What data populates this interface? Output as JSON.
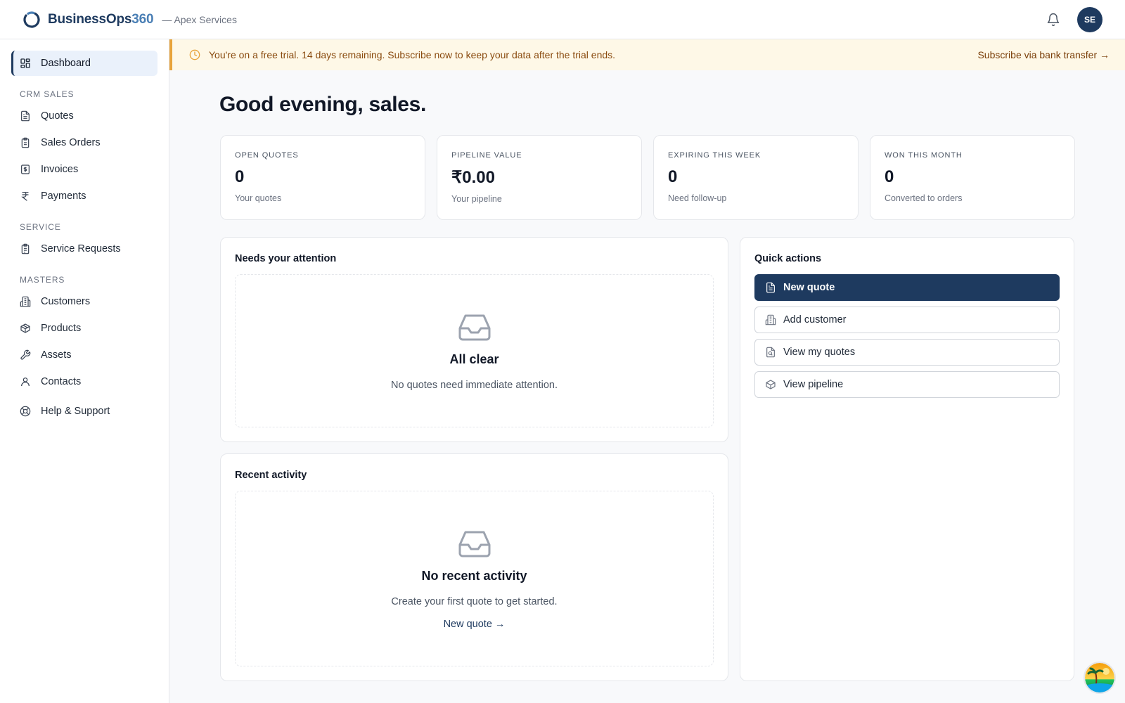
{
  "app": {
    "brand_name": "BusinessOps",
    "brand_num": "360",
    "org": "— Apex Services",
    "user_initials": "SE"
  },
  "sidebar": {
    "dashboard": "Dashboard",
    "sections": [
      {
        "title": "CRM SALES",
        "items": [
          "Quotes",
          "Sales Orders",
          "Invoices",
          "Payments"
        ]
      },
      {
        "title": "SERVICE",
        "items": [
          "Service Requests"
        ]
      },
      {
        "title": "MASTERS",
        "items": [
          "Customers",
          "Products",
          "Assets",
          "Contacts"
        ]
      }
    ],
    "help": "Help & Support"
  },
  "banner": {
    "text": "You're on a free trial. 14 days remaining. Subscribe now to keep your data after the trial ends.",
    "link": "Subscribe via bank transfer →"
  },
  "greeting": "Good evening, sales.",
  "kpis": [
    {
      "label": "OPEN QUOTES",
      "value": "0",
      "sub": "Your quotes"
    },
    {
      "label": "PIPELINE VALUE",
      "value": "₹0.00",
      "sub": "Your pipeline"
    },
    {
      "label": "EXPIRING THIS WEEK",
      "value": "0",
      "sub": "Need follow-up"
    },
    {
      "label": "WON THIS MONTH",
      "value": "0",
      "sub": "Converted to orders"
    }
  ],
  "attention": {
    "title": "Needs your attention",
    "empty_title": "All clear",
    "empty_desc": "No quotes need immediate attention."
  },
  "activity": {
    "title": "Recent activity",
    "empty_title": "No recent activity",
    "empty_desc": "Create your first quote to get started.",
    "empty_link": "New quote →"
  },
  "quick_actions": {
    "title": "Quick actions",
    "items": [
      "New quote",
      "Add customer",
      "View my quotes",
      "View pipeline"
    ]
  },
  "colors": {
    "primary": "#1e3a5f",
    "accent": "#4a7fb5",
    "banner_bg": "#fef8e7",
    "banner_border": "#e8a33a"
  }
}
